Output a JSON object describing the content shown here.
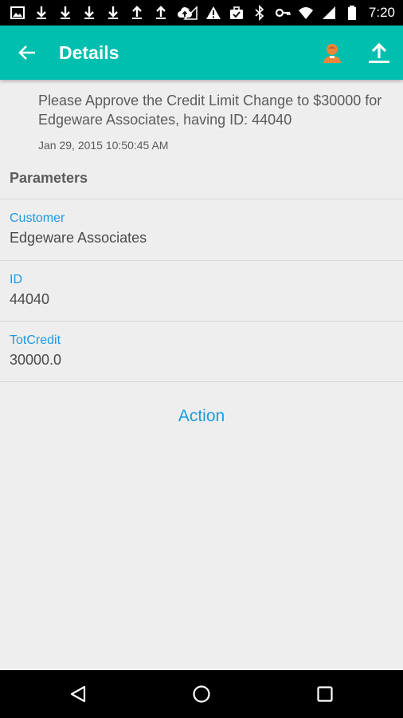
{
  "status_bar": {
    "time": "7:20",
    "left_icons": [
      "image-icon",
      "download-icon",
      "download-icon",
      "download-icon",
      "download-icon",
      "upload-icon",
      "upload-icon",
      "cloud-upload-icon"
    ],
    "right_icons": [
      "signal-unknown-icon",
      "warning-icon",
      "briefcase-check-icon",
      "bluetooth-icon",
      "key-icon",
      "wifi-icon",
      "cell-signal-icon",
      "battery-icon"
    ]
  },
  "app_bar": {
    "title": "Details",
    "background": "#00bfae",
    "user_icon_color": "#e8873a"
  },
  "message": {
    "text": "Please Approve the Credit Limit Change to $30000 for Edgeware Associates, having ID: 44040",
    "timestamp": "Jan 29, 2015 10:50:45 AM"
  },
  "parameters": {
    "heading": "Parameters",
    "items": [
      {
        "label": "Customer",
        "value": "Edgeware Associates"
      },
      {
        "label": "ID",
        "value": "44040"
      },
      {
        "label": "TotCredit",
        "value": "30000.0"
      }
    ]
  },
  "action": {
    "label": "Action",
    "color": "#1a9be0"
  }
}
